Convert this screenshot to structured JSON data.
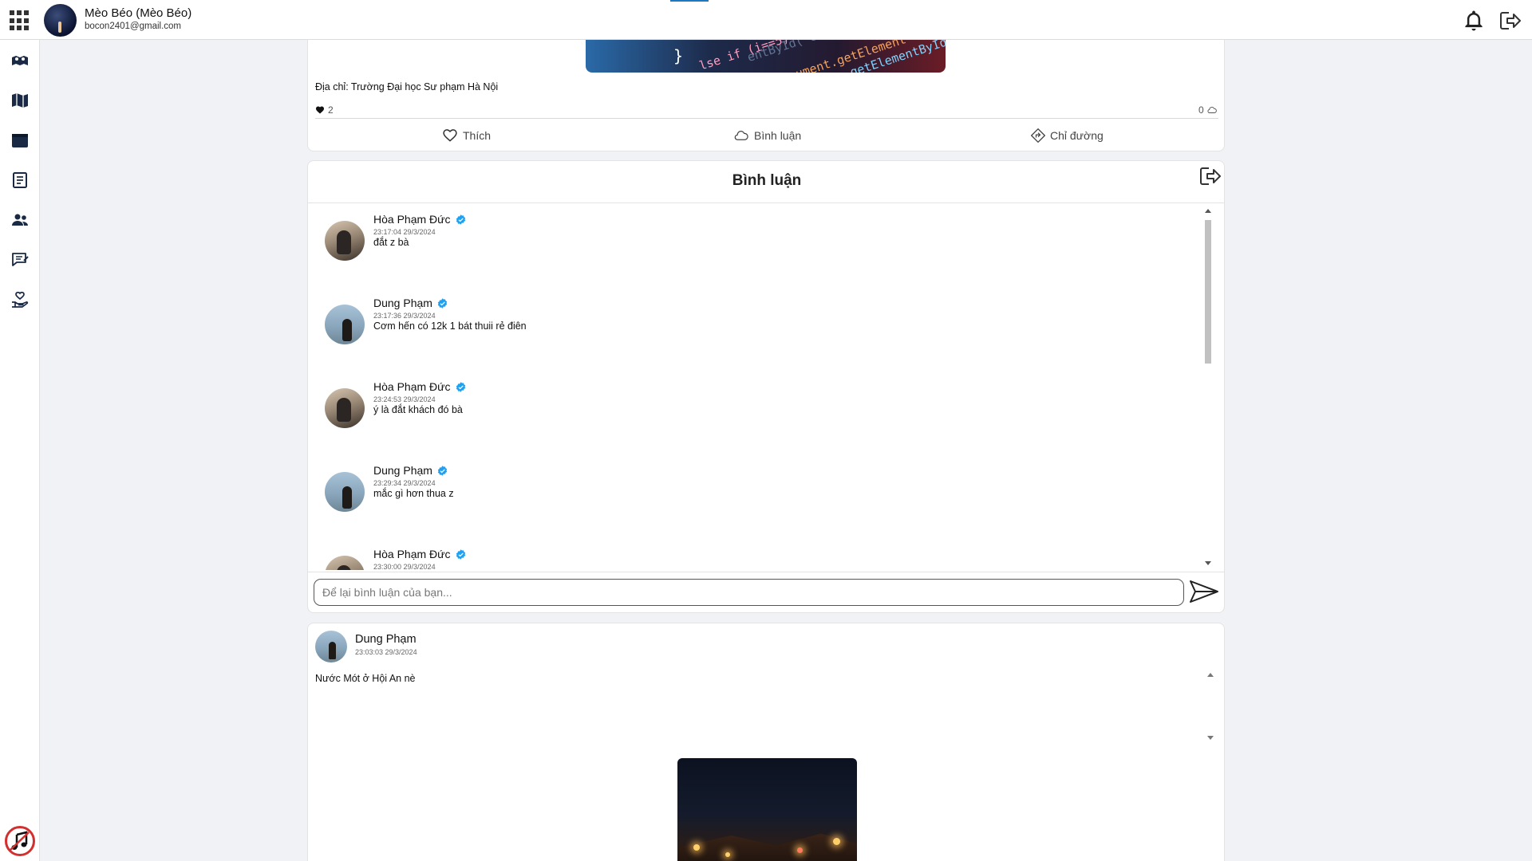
{
  "header": {
    "user_name": "Mèo Béo (Mèo Béo)",
    "user_email": "bocon2401@gmail.com",
    "icons": [
      "apps-grid-icon",
      "bell-icon",
      "logout-icon"
    ]
  },
  "sidebar": {
    "items": [
      {
        "icon": "map-pins-icon"
      },
      {
        "icon": "map-icon"
      },
      {
        "icon": "calendar-icon"
      },
      {
        "icon": "book-icon"
      },
      {
        "icon": "users-icon"
      },
      {
        "icon": "chat-edit-icon"
      },
      {
        "icon": "volunteer-icon"
      }
    ],
    "music_icon": "music-note-icon",
    "accent": "#d32f2f"
  },
  "post1": {
    "address": "Địa chỉ: Trường Đại học Sư phạm Hà Nội",
    "likes": "2",
    "comments_count": "0",
    "actions": {
      "like": "Thích",
      "comment": "Bình luận",
      "directions": "Chỉ đường"
    },
    "code_snippet_lines": [
      "}",
      "lse if (i==5)",
      "ument.getElement",
      ".getElementById",
      "entById('error"
    ]
  },
  "comments_panel": {
    "title": "Bình luận",
    "comments": [
      {
        "name": "Hòa Phạm Đức",
        "time": "23:17:04 29/3/2024",
        "text": "đắt z bà",
        "avatar": "hoa"
      },
      {
        "name": "Dung Phạm",
        "time": "23:17:36 29/3/2024",
        "text": "Cơm hến có 12k 1 bát thuii rẻ điên",
        "avatar": "dung"
      },
      {
        "name": "Hòa Phạm Đức",
        "time": "23:24:53 29/3/2024",
        "text": "ý là đắt khách đó bà",
        "avatar": "hoa"
      },
      {
        "name": "Dung Phạm",
        "time": "23:29:34 29/3/2024",
        "text": "mắc gì hơn thua z",
        "avatar": "dung"
      },
      {
        "name": "Hòa Phạm Đức",
        "time": "23:30:00 29/3/2024",
        "text": "",
        "avatar": "hoa"
      }
    ],
    "input_placeholder": "Để lại bình luận của bạn...",
    "verified_color": "#1da1f2"
  },
  "post2": {
    "author": "Dung Phạm",
    "time": "23:03:03 29/3/2024",
    "text": "Nước Mót ở Hội An nè"
  }
}
